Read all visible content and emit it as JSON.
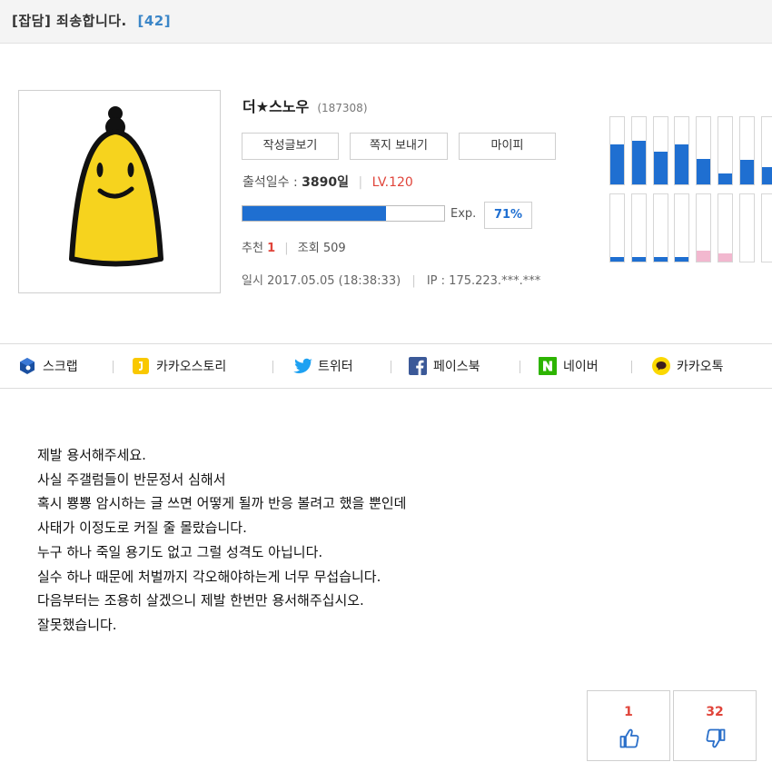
{
  "post": {
    "category": "[잡담]",
    "title": "죄송합니다.",
    "comment_count": "[42]"
  },
  "author": {
    "nickname": "더★스노우",
    "user_id": "(187308)",
    "avatar_icon": "yellow-character-avatar"
  },
  "buttons": {
    "view_posts": "작성글보기",
    "send_message": "쪽지 보내기",
    "mypi": "마이피"
  },
  "stats": {
    "attendance_label": "출석일수 :",
    "attendance_value": "3890일",
    "level": "LV.120",
    "exp_label": "Exp.",
    "exp_percent": "71%",
    "exp_fraction": 0.71,
    "recommend_label": "추천",
    "recommend_value": "1",
    "views_label": "조회",
    "views_value": "509",
    "date_label": "일시",
    "date_value": "2017.05.05 (18:38:33)",
    "ip_label": "IP :",
    "ip_value": "175.223.***.***"
  },
  "activity_chart": {
    "colors": {
      "top": "#1f6fd1",
      "bottom_blue": "#1f6fd1",
      "bottom_pink": "#f2b8cf"
    },
    "top_levels": [
      0.6,
      0.65,
      0.48,
      0.6,
      0.38,
      0.16,
      0.37,
      0.26
    ],
    "bottom_levels": [
      0.07,
      0.07,
      0.07,
      0.07,
      0.16,
      0.12,
      0,
      0
    ],
    "bottom_colors": [
      "blue",
      "blue",
      "blue",
      "blue",
      "pink",
      "pink",
      "none",
      "none"
    ]
  },
  "share": [
    {
      "label": "스크랩",
      "icon": "scrap-icon"
    },
    {
      "label": "카카오스토리",
      "icon": "kakaostory-icon"
    },
    {
      "label": "트위터",
      "icon": "twitter-icon"
    },
    {
      "label": "페이스북",
      "icon": "facebook-icon"
    },
    {
      "label": "네이버",
      "icon": "naver-icon"
    },
    {
      "label": "카카오톡",
      "icon": "kakaotalk-icon"
    }
  ],
  "content_lines": [
    "제발 용서해주세요.",
    "사실 주갤럼들이 반문정서 심해서",
    "혹시 뿅뿅 암시하는 글 쓰면 어떻게 될까 반응 볼려고 했을 뿐인데",
    "사태가 이정도로 커질 줄 몰랐습니다.",
    "누구 하나 죽일 용기도 없고 그럴 성격도 아닙니다.",
    "실수 하나 때문에 처벌까지 각오해야하는게 너무 무섭습니다.",
    "다음부터는 조용히 살겠으니 제발 한번만 용서해주십시오.",
    "잘못했습니다."
  ],
  "votes": {
    "up": "1",
    "down": "32",
    "up_icon": "thumbs-up-icon",
    "down_icon": "thumbs-down-icon"
  }
}
